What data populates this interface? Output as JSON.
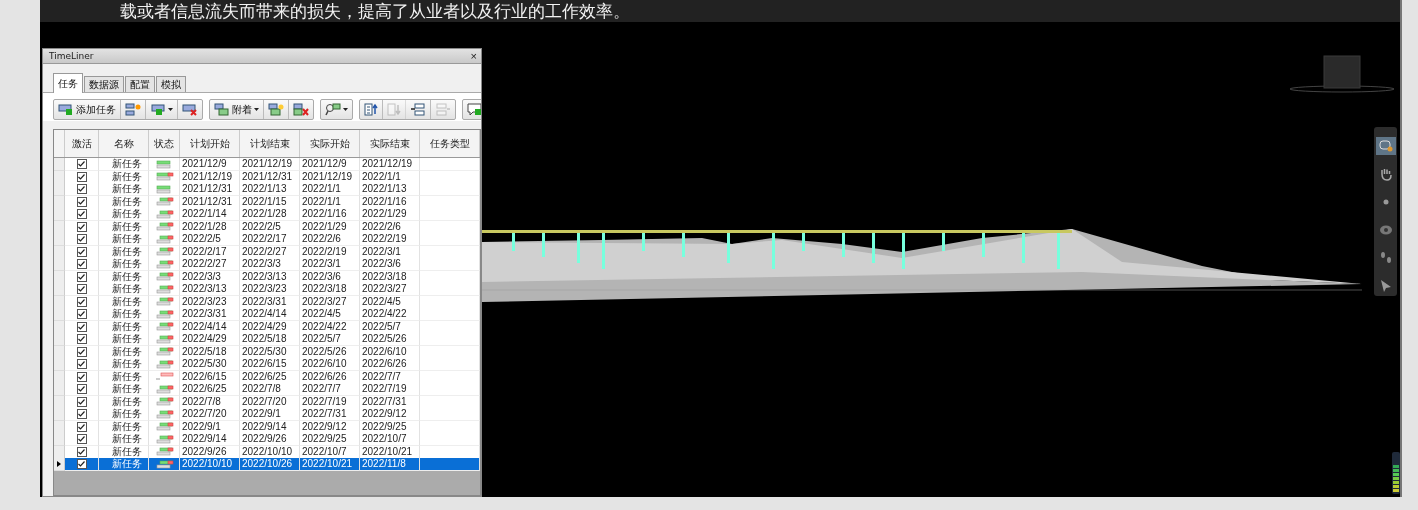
{
  "document_text": "载或者信息流失而带来的损失，提高了从业者以及行业的工作效率。",
  "panel": {
    "title": "TimeLiner",
    "close": "×"
  },
  "tabs": [
    {
      "label": "任务",
      "selected": true
    },
    {
      "label": "数据源",
      "selected": false
    },
    {
      "label": "配置",
      "selected": false
    },
    {
      "label": "模拟",
      "selected": false
    }
  ],
  "toolbar": [
    [
      {
        "kind": "add",
        "label": "添加任务",
        "menu": false,
        "disabled": false
      },
      {
        "kind": "outdent",
        "menu": false,
        "disabled": false
      },
      {
        "kind": "insert",
        "menu": true,
        "disabled": false
      },
      {
        "kind": "delete",
        "menu": false,
        "disabled": false
      }
    ],
    [
      {
        "kind": "attach",
        "label": "附着",
        "menu": true,
        "disabled": false
      },
      {
        "kind": "attach-add",
        "menu": false,
        "disabled": false
      },
      {
        "kind": "attach-remove",
        "menu": false,
        "disabled": false
      }
    ],
    [
      {
        "kind": "find",
        "menu": true,
        "disabled": false
      }
    ],
    [
      {
        "kind": "move-up",
        "menu": false,
        "disabled": false
      },
      {
        "kind": "move-down",
        "menu": false,
        "disabled": true
      },
      {
        "kind": "indent",
        "menu": false,
        "disabled": false
      },
      {
        "kind": "unindent",
        "menu": false,
        "disabled": true
      }
    ],
    [
      {
        "kind": "comment",
        "menu": false,
        "disabled": false
      }
    ]
  ],
  "table": {
    "columns": [
      "激活",
      "名称",
      "状态",
      "计划开始",
      "计划结束",
      "实际开始",
      "实际结束",
      "任务类型"
    ],
    "rows": [
      {
        "active": true,
        "name": "新任务",
        "kind": "on-time",
        "plan_start": "2021/12/9",
        "plan_end": "2021/12/19",
        "actual_start": "2021/12/9",
        "actual_end": "2021/12/19",
        "selected": false
      },
      {
        "active": true,
        "name": "新任务",
        "kind": "late-finish",
        "plan_start": "2021/12/19",
        "plan_end": "2021/12/31",
        "actual_start": "2021/12/19",
        "actual_end": "2022/1/1",
        "selected": false
      },
      {
        "active": true,
        "name": "新任务",
        "kind": "on-time",
        "plan_start": "2021/12/31",
        "plan_end": "2022/1/13",
        "actual_start": "2022/1/1",
        "actual_end": "2022/1/13",
        "selected": false
      },
      {
        "active": true,
        "name": "新任务",
        "kind": "late",
        "plan_start": "2021/12/31",
        "plan_end": "2022/1/15",
        "actual_start": "2022/1/1",
        "actual_end": "2022/1/16",
        "selected": false
      },
      {
        "active": true,
        "name": "新任务",
        "kind": "late",
        "plan_start": "2022/1/14",
        "plan_end": "2022/1/28",
        "actual_start": "2022/1/16",
        "actual_end": "2022/1/29",
        "selected": false
      },
      {
        "active": true,
        "name": "新任务",
        "kind": "late",
        "plan_start": "2022/1/28",
        "plan_end": "2022/2/5",
        "actual_start": "2022/1/29",
        "actual_end": "2022/2/6",
        "selected": false
      },
      {
        "active": true,
        "name": "新任务",
        "kind": "late",
        "plan_start": "2022/2/5",
        "plan_end": "2022/2/17",
        "actual_start": "2022/2/6",
        "actual_end": "2022/2/19",
        "selected": false
      },
      {
        "active": true,
        "name": "新任务",
        "kind": "late",
        "plan_start": "2022/2/17",
        "plan_end": "2022/2/27",
        "actual_start": "2022/2/19",
        "actual_end": "2022/3/1",
        "selected": false
      },
      {
        "active": true,
        "name": "新任务",
        "kind": "late",
        "plan_start": "2022/2/27",
        "plan_end": "2022/3/3",
        "actual_start": "2022/3/1",
        "actual_end": "2022/3/6",
        "selected": false
      },
      {
        "active": true,
        "name": "新任务",
        "kind": "late",
        "plan_start": "2022/3/3",
        "plan_end": "2022/3/13",
        "actual_start": "2022/3/6",
        "actual_end": "2022/3/18",
        "selected": false
      },
      {
        "active": true,
        "name": "新任务",
        "kind": "late",
        "plan_start": "2022/3/13",
        "plan_end": "2022/3/23",
        "actual_start": "2022/3/18",
        "actual_end": "2022/3/27",
        "selected": false
      },
      {
        "active": true,
        "name": "新任务",
        "kind": "late",
        "plan_start": "2022/3/23",
        "plan_end": "2022/3/31",
        "actual_start": "2022/3/27",
        "actual_end": "2022/4/5",
        "selected": false
      },
      {
        "active": true,
        "name": "新任务",
        "kind": "late",
        "plan_start": "2022/3/31",
        "plan_end": "2022/4/14",
        "actual_start": "2022/4/5",
        "actual_end": "2022/4/22",
        "selected": false
      },
      {
        "active": true,
        "name": "新任务",
        "kind": "late",
        "plan_start": "2022/4/14",
        "plan_end": "2022/4/29",
        "actual_start": "2022/4/22",
        "actual_end": "2022/5/7",
        "selected": false
      },
      {
        "active": true,
        "name": "新任务",
        "kind": "late",
        "plan_start": "2022/4/29",
        "plan_end": "2022/5/18",
        "actual_start": "2022/5/7",
        "actual_end": "2022/5/26",
        "selected": false
      },
      {
        "active": true,
        "name": "新任务",
        "kind": "late",
        "plan_start": "2022/5/18",
        "plan_end": "2022/5/30",
        "actual_start": "2022/5/26",
        "actual_end": "2022/6/10",
        "selected": false
      },
      {
        "active": true,
        "name": "新任务",
        "kind": "late",
        "plan_start": "2022/5/30",
        "plan_end": "2022/6/15",
        "actual_start": "2022/6/10",
        "actual_end": "2022/6/26",
        "selected": false
      },
      {
        "active": true,
        "name": "新任务",
        "kind": "after-end",
        "plan_start": "2022/6/15",
        "plan_end": "2022/6/25",
        "actual_start": "2022/6/26",
        "actual_end": "2022/7/7",
        "selected": false
      },
      {
        "active": true,
        "name": "新任务",
        "kind": "late",
        "plan_start": "2022/6/25",
        "plan_end": "2022/7/8",
        "actual_start": "2022/7/7",
        "actual_end": "2022/7/19",
        "selected": false
      },
      {
        "active": true,
        "name": "新任务",
        "kind": "late",
        "plan_start": "2022/7/8",
        "plan_end": "2022/7/20",
        "actual_start": "2022/7/19",
        "actual_end": "2022/7/31",
        "selected": false
      },
      {
        "active": true,
        "name": "新任务",
        "kind": "late",
        "plan_start": "2022/7/20",
        "plan_end": "2022/9/1",
        "actual_start": "2022/7/31",
        "actual_end": "2022/9/12",
        "selected": false
      },
      {
        "active": true,
        "name": "新任务",
        "kind": "late",
        "plan_start": "2022/9/1",
        "plan_end": "2022/9/14",
        "actual_start": "2022/9/12",
        "actual_end": "2022/9/25",
        "selected": false
      },
      {
        "active": true,
        "name": "新任务",
        "kind": "late",
        "plan_start": "2022/9/14",
        "plan_end": "2022/9/26",
        "actual_start": "2022/9/25",
        "actual_end": "2022/10/7",
        "selected": false
      },
      {
        "active": true,
        "name": "新任务",
        "kind": "late",
        "plan_start": "2022/9/26",
        "plan_end": "2022/10/10",
        "actual_start": "2022/10/7",
        "actual_end": "2022/10/21",
        "selected": false
      },
      {
        "active": true,
        "name": "新任务",
        "kind": "late",
        "plan_start": "2022/10/10",
        "plan_end": "2022/10/26",
        "actual_start": "2022/10/21",
        "actual_end": "2022/11/8",
        "selected": true
      }
    ]
  }
}
